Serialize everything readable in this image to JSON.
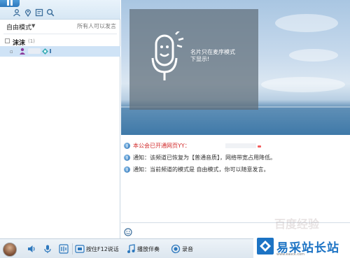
{
  "toolbar": {
    "icons": [
      "people-icon",
      "location-icon",
      "notes-icon",
      "search-icon"
    ]
  },
  "sidebar": {
    "mode_label": "自由模式",
    "status_text": "所有人可以发言",
    "channel": {
      "name": "沫沫",
      "count": "(1)"
    }
  },
  "video": {
    "notice_line1": "名片只在麦序模式",
    "notice_line2": "下显示!"
  },
  "messages": [
    {
      "text": "本公会已开通网页YY：",
      "color": "#d22b2b"
    },
    {
      "text": "通知：该频道已恢复为【普通音质】，网络带宽占用降低。",
      "color": "#333333"
    },
    {
      "text": "通知：当前频道的模式是 自由模式，你可以随意发言。",
      "color": "#333333"
    }
  ],
  "bottom_bar": {
    "ptt_label": "按住F12说话",
    "music_label": "播放伴奏",
    "record_label": "录音"
  },
  "watermark": {
    "brand": "易采站长站",
    "url": "www.easck.com",
    "ghost": "百度经验"
  },
  "colors": {
    "accent": "#2d78bd",
    "selected_row": "#cfe3f6",
    "alert_red": "#d22b2b"
  }
}
